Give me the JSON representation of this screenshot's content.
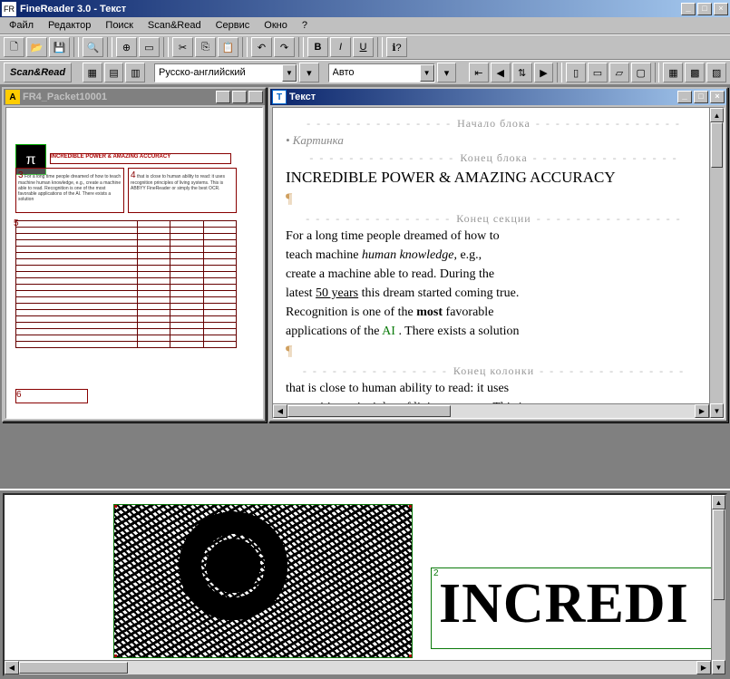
{
  "app": {
    "title": "FineReader 3.0 - Текст",
    "icon_label": "FR"
  },
  "menu": [
    "Файл",
    "Редактор",
    "Поиск",
    "Scan&Read",
    "Сервис",
    "Окно",
    "?"
  ],
  "toolbar1": {
    "items": [
      "new",
      "open",
      "save",
      "sep",
      "find",
      "sep",
      "zoom_icon",
      "page_icon",
      "sep",
      "cut",
      "copy",
      "paste",
      "sep",
      "undo",
      "redo",
      "sep",
      "bold",
      "italic",
      "underline",
      "sep",
      "help"
    ],
    "labels": {
      "bold": "B",
      "italic": "I",
      "underline": "U"
    }
  },
  "toolbar2": {
    "scanread_label": "Scan&Read",
    "small_buttons_left": [
      "thumb1",
      "thumb2",
      "thumb3"
    ],
    "lang_combo": "Русско-английский",
    "style_combo": "Авто",
    "right_buttons": [
      "nav-first",
      "nav-prev",
      "nav-goto",
      "nav-next",
      "sep",
      "layout1",
      "layout2",
      "layout3",
      "layout4",
      "sep",
      "grid1",
      "grid2",
      "grid3"
    ]
  },
  "left_window": {
    "title": "FR4_Packet10001",
    "icon_letter": "A",
    "preview": {
      "heading_small": "INCREDIBLE POWER & AMAZING ACCURACY",
      "block_numbers": [
        "3",
        "4",
        "5",
        "6"
      ],
      "tiny_text_col1": "For a long time people dreamed of how to teach machine human knowledge, e.g., create a machine able to read. Recognition is one of the most favorable applications of the AI. There exists a solution",
      "tiny_text_col2": "that is close to human ability to read: it uses recognition principles of living systems. This is ABBYY FineReader or simply the best OCR."
    }
  },
  "right_window": {
    "title": "Текст",
    "markers": {
      "block_start": "Начало блока",
      "block_end": "Конец блока",
      "section_end": "Конец секции",
      "column_end": "Конец колонки"
    },
    "picture_label": "• Картинка",
    "heading": "INCREDIBLE POWER & AMAZING ACCURACY",
    "body_lines": [
      "For a long time people dreamed of how to",
      "teach machine ",
      ", e.g.,",
      "create a machine able to read. During the",
      "latest ",
      " this dream started coming true.",
      "Recognition is one of the ",
      " favorable",
      "applications of the ",
      " . There exists a solution"
    ],
    "italic_fragment": "human knowledge",
    "underline_fragment": "50 years",
    "bold_fragment": "most",
    "green_fragment": "AI",
    "after_column_lines": [
      "that is close to human ability to read: it uses",
      "recognition principles of living systems. This is"
    ]
  },
  "zoom_panel": {
    "region_index": "2",
    "big_word": "INCREDI"
  }
}
